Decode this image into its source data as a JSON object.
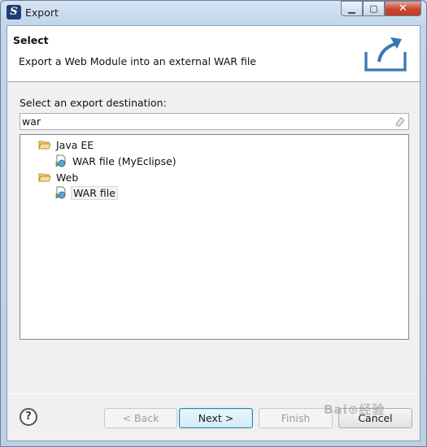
{
  "window": {
    "title": "Export",
    "app_icon_letter": "S",
    "controls": {
      "minimize": "▁",
      "maximize": "▢",
      "close": "✕"
    }
  },
  "header": {
    "title": "Select",
    "description": "Export a Web Module into an external WAR file"
  },
  "destination_label": "Select an export destination:",
  "filter": {
    "value": "war"
  },
  "tree": [
    {
      "label": "Java EE",
      "icon": "folder-open-icon",
      "children": [
        {
          "label": "WAR file (MyEclipse)",
          "icon": "war-file-icon"
        }
      ]
    },
    {
      "label": "Web",
      "icon": "folder-open-icon",
      "children": [
        {
          "label": "WAR file",
          "icon": "war-file-icon",
          "selected": true
        }
      ]
    }
  ],
  "buttons": {
    "help": "?",
    "back": "< Back",
    "next": "Next >",
    "finish": "Finish",
    "cancel": "Cancel"
  },
  "watermark": "Bai⊙经验",
  "colors": {
    "accent": "#3c7fb1",
    "folder": "#e8c15a",
    "close": "#c84531"
  }
}
